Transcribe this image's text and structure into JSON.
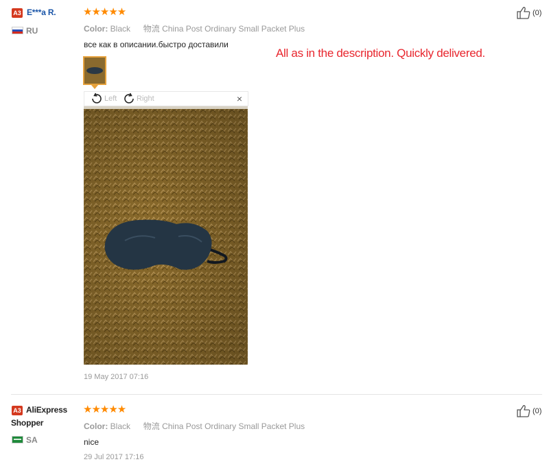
{
  "reviews": [
    {
      "badge": "A3",
      "user": "E***a R.",
      "country": "RU",
      "stars": "★★★★★",
      "rating": 5,
      "color_label": "Color:",
      "color_value": "Black",
      "shipping_label": "物流",
      "shipping_value": "China Post Ordinary Small Packet Plus",
      "text": "все как в описании.быстро доставили",
      "date": "19 May 2017 07:16",
      "likes": "(0)"
    },
    {
      "badge": "A3",
      "user_line1": "AliExpress",
      "user_line2": "Shopper",
      "country": "SA",
      "stars": "★★★★★",
      "rating": 5,
      "color_label": "Color:",
      "color_value": "Black",
      "shipping_label": "物流",
      "shipping_value": "China Post Ordinary Small Packet Plus",
      "text": "nice",
      "date": "29 Jul 2017 17:16",
      "likes": "(0)"
    }
  ],
  "translation": "All as in the description. Quickly delivered.",
  "viewer": {
    "rotate_left": "Left",
    "rotate_right": "Right",
    "close": "×"
  },
  "colors": {
    "accent_orange": "#ff8a00",
    "badge_red": "#d4391f",
    "translation_red": "#e8262e",
    "username_blue": "#1a55a8"
  }
}
